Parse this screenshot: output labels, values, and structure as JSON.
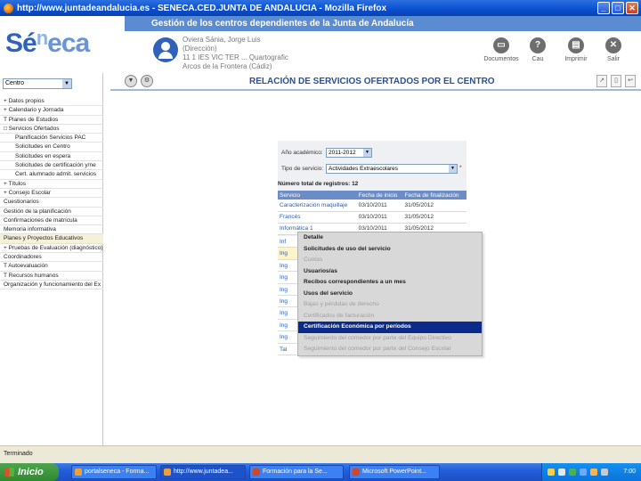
{
  "window": {
    "title": "http://www.juntadeandalucia.es - SENECA.CED.JUNTA DE ANDALUCIA - Mozilla Firefox"
  },
  "header": {
    "banner": "Gestión de los centros dependientes de la Junta de Andalucía",
    "logo": {
      "part1": "Sé",
      "sup": "n",
      "part2": "eca"
    },
    "user_lines": [
      "Oviera Sánia, Jorge Luis",
      "(Dirección)",
      "11 1 IES VIC TER ... Quartografic",
      "Arcos de la Frontera (Cádiz)"
    ],
    "tools": [
      {
        "label": "Documentos",
        "icon": "documents-icon"
      },
      {
        "label": "Cau",
        "icon": "help-icon"
      },
      {
        "label": "Imprimir",
        "icon": "print-icon"
      },
      {
        "label": "Salir",
        "icon": "exit-icon"
      }
    ]
  },
  "sidebar": {
    "role": "Centro",
    "menu": [
      {
        "label": "+ Datos propios",
        "sub": false
      },
      {
        "label": "+ Calendario y Jornada",
        "sub": false
      },
      {
        "label": "T Planes de Estudios",
        "sub": false
      },
      {
        "label": "□ Servicios Ofertados",
        "sub": false
      },
      {
        "label": "Planificación Servicios PAC",
        "sub": true
      },
      {
        "label": "Solicitudes en Centro",
        "sub": true
      },
      {
        "label": "Solicitudes en espera",
        "sub": true
      },
      {
        "label": "Solicitudes de certificación y/ne",
        "sub": true
      },
      {
        "label": "Cert. alumnado admit. servicios",
        "sub": true
      },
      {
        "label": "+ Títulos",
        "sub": false
      },
      {
        "label": "+ Consejo Escolar",
        "sub": false
      },
      {
        "label": "Cuestionarios",
        "sub": false
      },
      {
        "label": "Gestión de la planificación",
        "sub": false
      },
      {
        "label": "Confirmaciones de matrícula",
        "sub": false
      },
      {
        "label": "Memoria informativa",
        "sub": false
      },
      {
        "label": "Planes y Proyectos Educativos",
        "sub": false
      },
      {
        "label": "+ Pruebas de Evaluación (diagnóstico)",
        "sub": false
      },
      {
        "label": "Coordinadores",
        "sub": false
      },
      {
        "label": "T Autoevaluación",
        "sub": false
      },
      {
        "label": "T Recursos humanos",
        "sub": false
      },
      {
        "label": "Organización y funcionamiento del Ex",
        "sub": false
      }
    ]
  },
  "content": {
    "title": "RELACIÓN DE SERVICIOS OFERTADOS POR EL CENTRO",
    "form": {
      "year_label": "Año académico:",
      "year_value": "2011-2012",
      "type_label": "Tipo de servicio:",
      "type_value": "Actividades Extraescolares",
      "required_mark": "*"
    },
    "total_label": "Número total de registros: 12",
    "table": {
      "headers": [
        "Servicio",
        "Fecha de inicio",
        "Fecha de finalización"
      ],
      "rows": [
        [
          "Caracterización maquillaje",
          "03/10/2011",
          "31/05/2012"
        ],
        [
          "Francés",
          "03/10/2011",
          "31/05/2012"
        ],
        [
          "Informática 1",
          "03/10/2011",
          "31/05/2012"
        ]
      ],
      "stubs": [
        "Inf",
        "Ing",
        "Ing",
        "Ing",
        "Ing",
        "Ing",
        "Ing",
        "Ing",
        "Ing",
        "Tal"
      ]
    }
  },
  "context_menu": [
    {
      "label": "Detalle",
      "state": "enabled"
    },
    {
      "label": "Solicitudes de uso del servicio",
      "state": "enabled"
    },
    {
      "label": "Cuotas",
      "state": "disabled"
    },
    {
      "label": "Usuarios/as",
      "state": "enabled"
    },
    {
      "label": "Recibos correspondientes a un mes",
      "state": "enabled"
    },
    {
      "label": "Usos del servicio",
      "state": "enabled"
    },
    {
      "label": "Bajas y pérdidas de derecho",
      "state": "disabled"
    },
    {
      "label": "Certificados de facturación",
      "state": "disabled"
    },
    {
      "label": "Certificación Económica por períodos",
      "state": "selected"
    },
    {
      "label": "Seguimiento del comedor por parte del Equipo Directivo",
      "state": "disabled"
    },
    {
      "label": "Seguimiento del comedor por parte del Consejo Escolar",
      "state": "disabled"
    }
  ],
  "status": {
    "text": "Terminado"
  },
  "taskbar": {
    "start": "Inicio",
    "tasks": [
      "portalseneca - Forma...",
      "http://www.juntadea...",
      "Formación para la Se...",
      "Microsoft PowerPoint..."
    ],
    "clock": "7:00"
  }
}
